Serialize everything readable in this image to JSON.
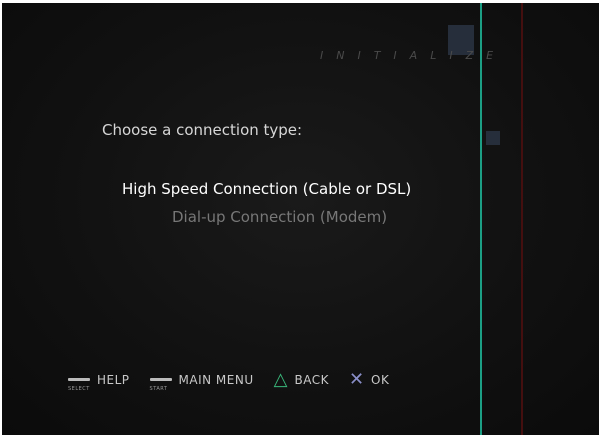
{
  "header": {
    "title": "INITIALIZE"
  },
  "prompt": {
    "text": "Choose a connection type:"
  },
  "options": [
    {
      "label": "High Speed Connection (Cable or DSL)",
      "state": "selected"
    },
    {
      "label": "Dial-up Connection (Modem)",
      "state": "normal"
    }
  ],
  "controls": {
    "select": {
      "button": "SELECT",
      "label": "HELP"
    },
    "start": {
      "button": "START",
      "label": "MAIN MENU"
    },
    "triangle": {
      "icon": "triangle-icon",
      "symbol": "△",
      "label": "BACK"
    },
    "cross": {
      "icon": "cross-icon",
      "symbol": "✕",
      "label": "OK"
    }
  },
  "colors": {
    "selected_text": "#ffffff",
    "unselected_text": "#777777",
    "triangle": "#39b77a",
    "cross": "#8a8fc9"
  }
}
